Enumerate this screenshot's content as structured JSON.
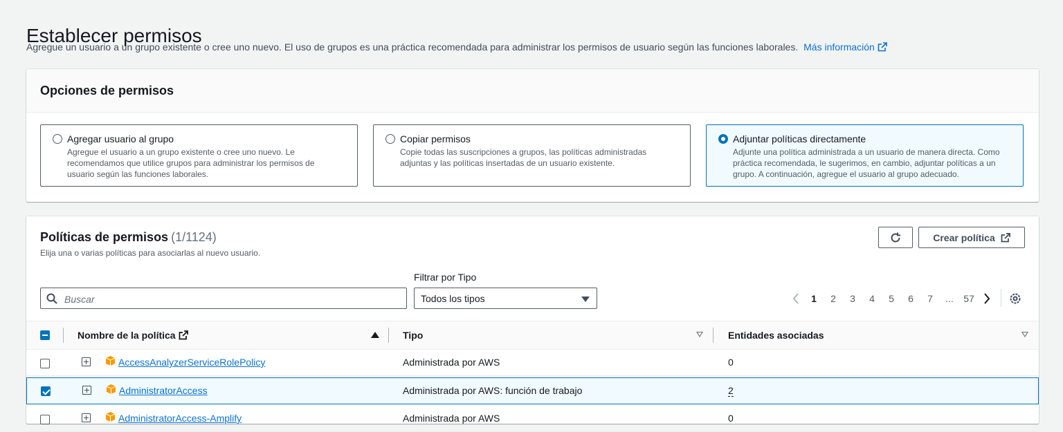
{
  "page": {
    "title": "Establecer permisos",
    "description": "Agregue un usuario a un grupo existente o cree uno nuevo. El uso de grupos es una práctica recomendada para administrar los permisos de usuario según las funciones laborales.",
    "more_info_link": "Más información"
  },
  "options": {
    "header": "Opciones de permisos",
    "tiles": [
      {
        "label": "Agregar usuario al grupo",
        "description": "Agregue el usuario a un grupo existente o cree uno nuevo. Le recomendamos que utilice grupos para administrar los permisos de usuario según las funciones laborales.",
        "selected": false
      },
      {
        "label": "Copiar permisos",
        "description": "Copie todas las suscripciones a grupos, las políticas administradas adjuntas y las políticas insertadas de un usuario existente.",
        "selected": false
      },
      {
        "label": "Adjuntar políticas directamente",
        "description": "Adjunte una política administrada a un usuario de manera directa. Como práctica recomendada, le sugerimos, en cambio, adjuntar políticas a un grupo. A continuación, agregue el usuario al grupo adecuado.",
        "selected": true
      }
    ]
  },
  "policies": {
    "title": "Políticas de permisos",
    "count": "(1/1124)",
    "description": "Elija una o varias políticas para asociarlas al nuevo usuario.",
    "refresh_icon": "refresh-icon",
    "create_label": "Crear política",
    "search_placeholder": "Buscar",
    "filter_label": "Filtrar por Tipo",
    "filter_value": "Todos los tipos",
    "pagination": {
      "pages": [
        "1",
        "2",
        "3",
        "4",
        "5",
        "6",
        "7",
        "...",
        "57"
      ],
      "current": "1"
    },
    "columns": {
      "name": "Nombre de la política",
      "type": "Tipo",
      "entities": "Entidades asociadas"
    },
    "rows": [
      {
        "name": "AccessAnalyzerServiceRolePolicy",
        "type": "Administrada por AWS",
        "entities": "0",
        "checked": false
      },
      {
        "name": "AdministratorAccess",
        "type": "Administrada por AWS: función de trabajo",
        "entities": "2",
        "checked": true
      },
      {
        "name": "AdministratorAccess-Amplify",
        "type": "Administrada por AWS",
        "entities": "0",
        "checked": false
      }
    ]
  },
  "colors": {
    "accent": "#0073bb",
    "link": "#0972d3",
    "aws_icon": "#ff9900"
  }
}
